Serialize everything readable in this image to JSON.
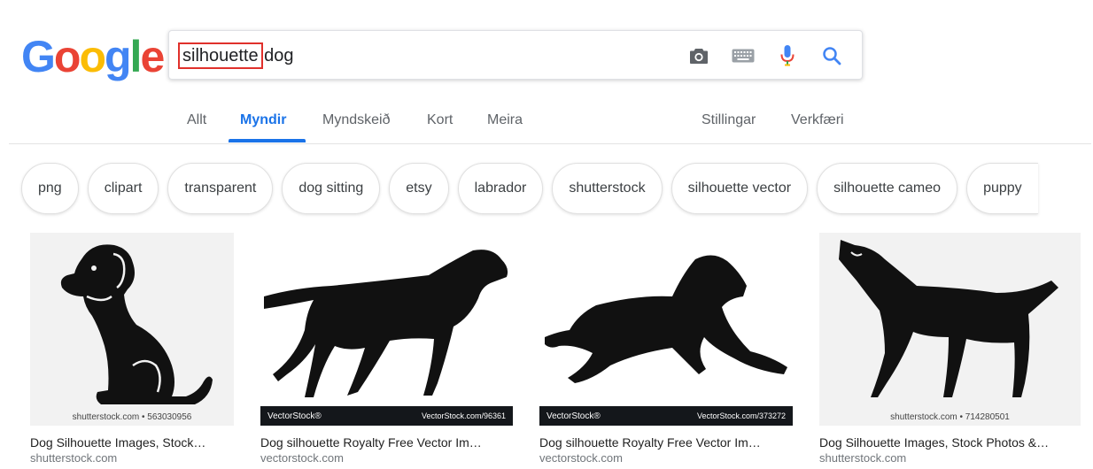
{
  "logo": {
    "letters": [
      {
        "char": "G",
        "color": "#4285F4"
      },
      {
        "char": "o",
        "color": "#EA4335"
      },
      {
        "char": "o",
        "color": "#FBBC05"
      },
      {
        "char": "g",
        "color": "#4285F4"
      },
      {
        "char": "l",
        "color": "#34A853"
      },
      {
        "char": "e",
        "color": "#EA4335"
      }
    ]
  },
  "search": {
    "query_highlight": "silhouette",
    "query_rest": " dog",
    "icons": [
      "camera-icon",
      "keyboard-icon",
      "microphone-icon",
      "search-icon"
    ]
  },
  "tabs": {
    "items": [
      {
        "label": "Allt",
        "active": false
      },
      {
        "label": "Myndir",
        "active": true
      },
      {
        "label": "Myndskeið",
        "active": false
      },
      {
        "label": "Kort",
        "active": false
      },
      {
        "label": "Meira",
        "active": false
      }
    ],
    "right": [
      {
        "label": "Stillingar"
      },
      {
        "label": "Verkfæri"
      }
    ]
  },
  "chips": [
    "png",
    "clipart",
    "transparent",
    "dog sitting",
    "etsy",
    "labrador",
    "shutterstock",
    "silhouette vector",
    "silhouette cameo",
    "puppy"
  ],
  "results": [
    {
      "title": "Dog Silhouette Images, Stock…",
      "source": "shutterstock.com",
      "watermark": "shutterstock.com • 563030956"
    },
    {
      "title": "Dog silhouette Royalty Free Vector Im…",
      "source": "vectorstock.com",
      "watermark": "VectorStock®",
      "watermark_right": "VectorStock.com/96361"
    },
    {
      "title": "Dog silhouette Royalty Free Vector Im…",
      "source": "vectorstock.com",
      "watermark": "VectorStock®",
      "watermark_right": "VectorStock.com/373272"
    },
    {
      "title": "Dog Silhouette Images, Stock Photos &…",
      "source": "shutterstock.com",
      "watermark": "shutterstock.com • 714280501"
    }
  ],
  "colors": {
    "accent": "#1a73e8",
    "highlight_box": "#e0302b",
    "thumb_bg": "#ebebeb"
  }
}
